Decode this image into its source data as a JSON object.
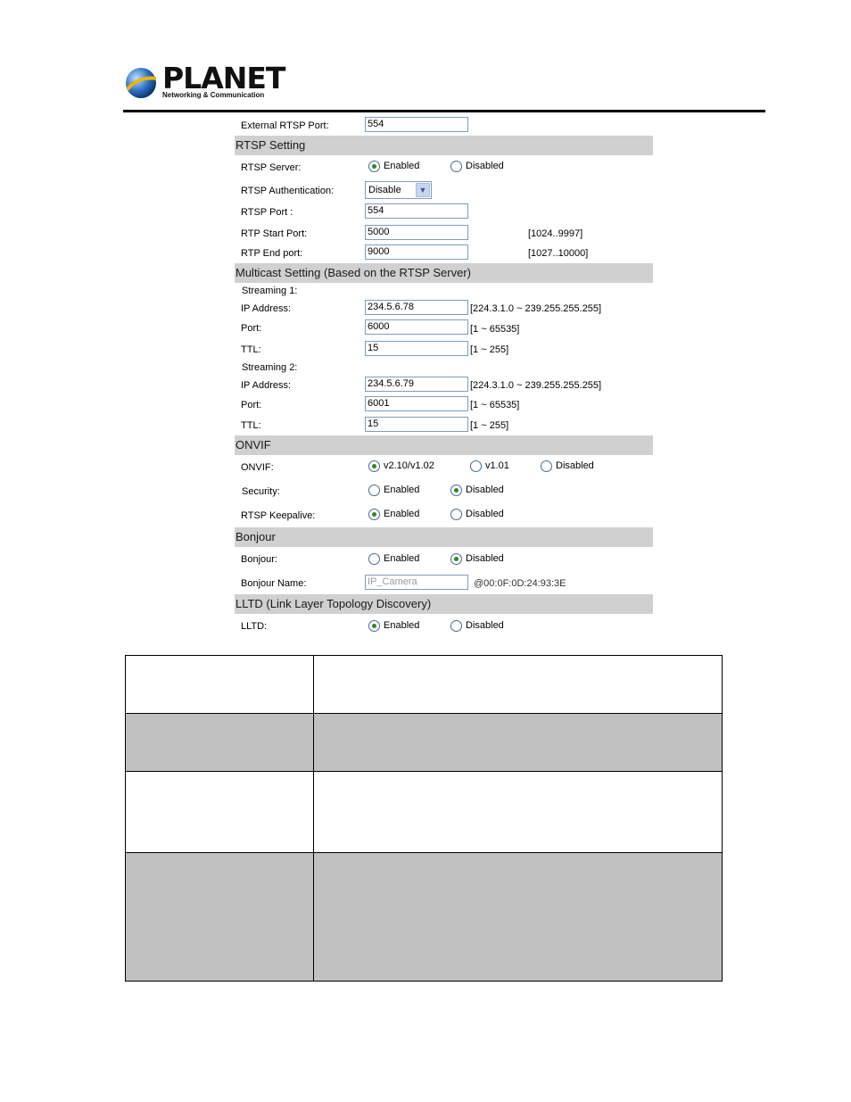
{
  "header": {
    "brand": "PLANET",
    "tagline": "Networking & Communication"
  },
  "panel": {
    "external_rtsp_port": {
      "label": "External RTSP Port:",
      "value": "554"
    },
    "sections": {
      "rtsp": "RTSP Setting",
      "multicast": "Multicast Setting (Based on the RTSP Server)",
      "onvif": "ONVIF",
      "bonjour": "Bonjour",
      "lltd": "LLTD (Link Layer Topology Discovery)"
    },
    "rtsp": {
      "server_label": "RTSP Server:",
      "server_enabled": "Enabled",
      "server_disabled": "Disabled",
      "auth_label": "RTSP Authentication:",
      "auth_value": "Disable",
      "port_label": "RTSP Port :",
      "port_value": "554",
      "rtp_start_label": "RTP Start Port:",
      "rtp_start_value": "5000",
      "rtp_start_range": "[1024..9997]",
      "rtp_end_label": "RTP End port:",
      "rtp_end_value": "9000",
      "rtp_end_range": "[1027..10000]"
    },
    "multicast": {
      "streaming1_label": "Streaming 1:",
      "streaming2_label": "Streaming 2:",
      "ip_label": "IP Address:",
      "port_label": "Port:",
      "ttl_label": "TTL:",
      "ip_range": "[224.3.1.0 ~ 239.255.255.255]",
      "port_range": "[1 ~ 65535]",
      "ttl_range": "[1 ~ 255]",
      "s1_ip": "234.5.6.78",
      "s1_port": "6000",
      "s1_ttl": "15",
      "s2_ip": "234.5.6.79",
      "s2_port": "6001",
      "s2_ttl": "15"
    },
    "onvif": {
      "onvif_label": "ONVIF:",
      "opt_v210": "v2.10/v1.02",
      "opt_v101": "v1.01",
      "opt_disabled": "Disabled",
      "security_label": "Security:",
      "keepalive_label": "RTSP Keepalive:",
      "enabled": "Enabled",
      "disabled": "Disabled"
    },
    "bonjour": {
      "bonjour_label": "Bonjour:",
      "name_label": "Bonjour Name:",
      "name_value": "IP_Camera",
      "name_suffix": "@00:0F:0D:24:93:3E",
      "enabled": "Enabled",
      "disabled": "Disabled"
    },
    "lltd": {
      "lltd_label": "LLTD:",
      "enabled": "Enabled",
      "disabled": "Disabled"
    }
  },
  "selected": {
    "rtsp_server": "Enabled",
    "onvif": "v2.10/v1.02",
    "security": "Disabled",
    "keepalive": "Enabled",
    "bonjour": "Disabled",
    "lltd": "Enabled"
  },
  "colors": {
    "section_bar": "#d0d0d0",
    "radio_dot": "#2a8a2a",
    "table_grey": "#c0c0c0"
  }
}
